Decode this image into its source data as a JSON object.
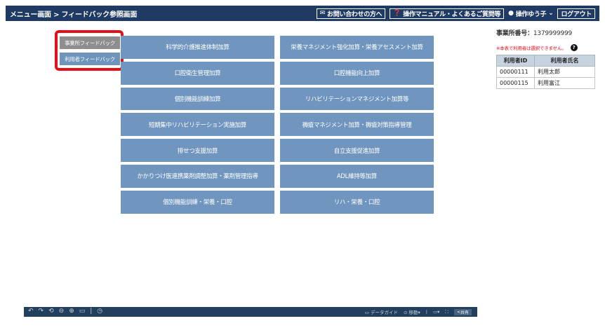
{
  "header": {
    "breadcrumb": "メニュー画面 > フィードバック参照画面",
    "contact_label": "お問い合わせの方へ",
    "manual_label": "操作マニュアル・よくあるご質問等",
    "user_label": "操作ゆう子",
    "logout_label": "ログアウト",
    "icons": {
      "contact": "mail-icon",
      "manual": "question-circle-icon",
      "user": "user-icon",
      "dropdown": "chevron-down-icon"
    }
  },
  "side_buttons": {
    "office_feedback": "事業所フィードバック",
    "user_feedback": "利用者フィードバック",
    "highlight_color": "#e3101a"
  },
  "menu": [
    "科学的介護推進体制加算",
    "栄養マネジメント強化加算・栄養アセスメント加算",
    "口腔衛生管理加算",
    "口腔機能向上加算",
    "個別機能訓練加算",
    "リハビリテーションマネジメント加算等",
    "短期集中リハビリテーション実施加算",
    "褥瘡マネジメント加算・褥瘡対策指導管理",
    "排せつ支援加算",
    "自立支援促進加算",
    "かかりつけ医連携薬剤調整加算・薬剤管理指導",
    "ADL維持等加算",
    "個別機能訓練・栄養・口腔",
    "リハ・栄養・口腔"
  ],
  "panel": {
    "office_label": "事業所番号：",
    "office_number": "1379999999",
    "notice": "※本表で利用者は選択できません。",
    "columns": [
      "利用者ID",
      "利用者氏名"
    ],
    "rows": [
      [
        "00000111",
        "利用太郎"
      ],
      [
        "00000115",
        "利用富江"
      ]
    ]
  },
  "toolbar": {
    "data_guide": "データガイド",
    "move_label": "移動",
    "share_label": "共有"
  },
  "colors": {
    "header_bg": "#1f3b63",
    "menu_button": "#7096bf",
    "table_header": "#c8d3e0",
    "notice": "#e3101a"
  }
}
